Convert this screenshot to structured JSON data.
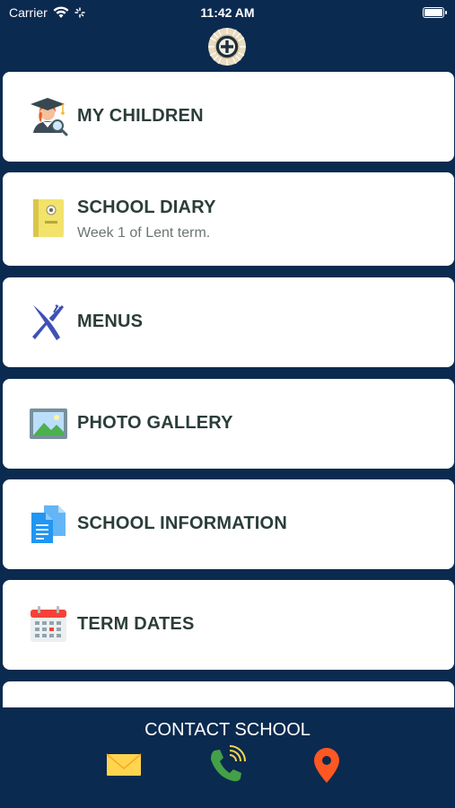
{
  "status_bar": {
    "carrier": "Carrier",
    "time": "11:42 AM"
  },
  "menu": {
    "items": [
      {
        "label": "MY CHILDREN",
        "icon": "graduate-student-icon"
      },
      {
        "label": "SCHOOL DIARY",
        "subtitle": "Week 1 of Lent term.",
        "icon": "diary-book-icon"
      },
      {
        "label": "MENUS",
        "icon": "fork-knife-icon"
      },
      {
        "label": "PHOTO GALLERY",
        "icon": "picture-frame-icon"
      },
      {
        "label": "SCHOOL INFORMATION",
        "icon": "documents-icon"
      },
      {
        "label": "TERM DATES",
        "icon": "calendar-icon"
      }
    ]
  },
  "contact": {
    "title": "CONTACT SCHOOL",
    "actions": [
      {
        "name": "email",
        "icon": "envelope-icon"
      },
      {
        "name": "phone",
        "icon": "phone-icon"
      },
      {
        "name": "location",
        "icon": "map-pin-icon"
      }
    ]
  },
  "colors": {
    "background": "#0b2a4f",
    "card": "#ffffff",
    "title_text": "#2b3d3a",
    "subtitle_text": "#6b7572"
  }
}
